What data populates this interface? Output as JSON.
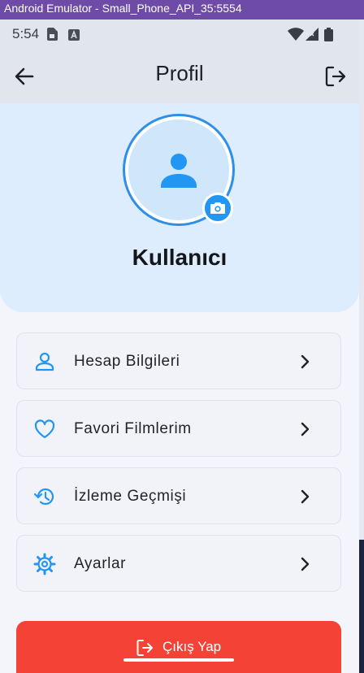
{
  "window": {
    "title": "Android Emulator - Small_Phone_API_35:5554"
  },
  "status_bar": {
    "time": "5:54",
    "icons": [
      "sim-card-icon",
      "a-notification-icon",
      "wifi-icon",
      "cell-signal-icon",
      "battery-icon"
    ]
  },
  "app_bar": {
    "title": "Profil",
    "back_icon": "arrow-back-icon",
    "action_icon": "logout-icon"
  },
  "profile": {
    "username": "Kullanıcı",
    "avatar_icon": "person-icon",
    "camera_icon": "camera-icon"
  },
  "menu": {
    "items": [
      {
        "label": "Hesap Bilgileri",
        "icon": "person-outline-icon"
      },
      {
        "label": "Favori Filmlerim",
        "icon": "heart-icon"
      },
      {
        "label": "İzleme Geçmişi",
        "icon": "history-icon"
      },
      {
        "label": "Ayarlar",
        "icon": "gear-icon"
      }
    ]
  },
  "logout_button": {
    "label": "Çıkış Yap",
    "icon": "logout-icon"
  },
  "colors": {
    "accent": "#2196f3",
    "danger": "#f44336",
    "hero_bg": "#deedfd",
    "app_bar_bg": "#e1e5ec"
  }
}
